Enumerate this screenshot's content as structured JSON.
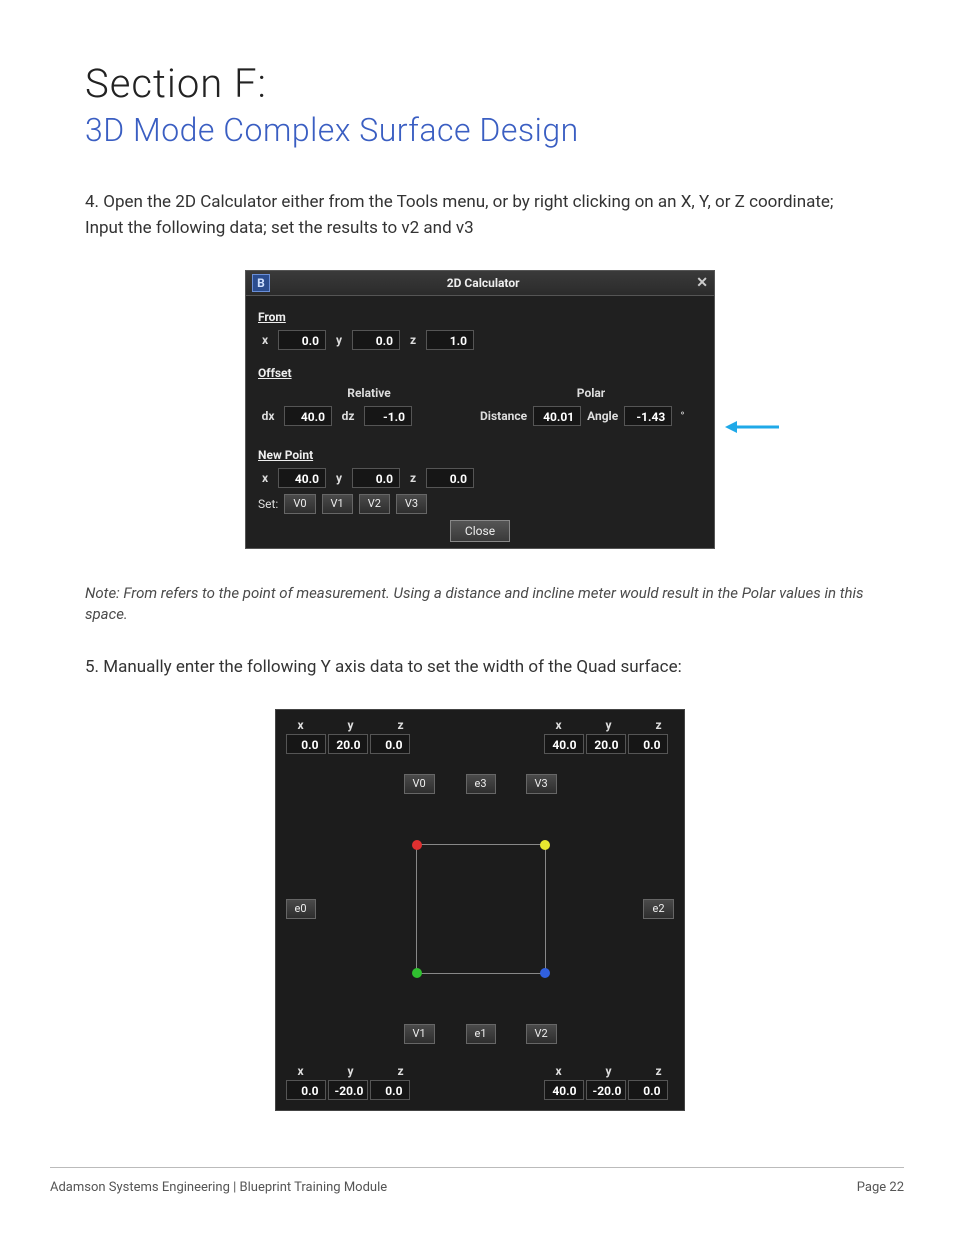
{
  "header": {
    "section": "Section F:",
    "title": "3D Mode Complex Surface Design"
  },
  "step4": {
    "num": "4.",
    "text": "Open the 2D Calculator either from the Tools menu, or by right clicking on an X, Y, or Z coordinate; Input the following data; set the results to v2 and v3"
  },
  "step5": {
    "num": "5.",
    "text": "Manually enter the following Y axis data to set the width of the Quad surface:"
  },
  "note": "Note: From refers to the point of measurement. Using a distance and incline meter would result in the Polar values in this space.",
  "calc": {
    "appIcon": "B",
    "title": "2D Calculator",
    "fromLabel": "From",
    "from": {
      "x": "0.0",
      "y": "0.0",
      "z": "1.0"
    },
    "offsetLabel": "Offset",
    "relativeLabel": "Relative",
    "polarLabel": "Polar",
    "relative": {
      "dx": "40.0",
      "dz": "-1.0"
    },
    "polar": {
      "distanceLabel": "Distance",
      "distance": "40.01",
      "angleLabel": "Angle",
      "angle": "-1.43",
      "unit": "°"
    },
    "newPointLabel": "New Point",
    "newPoint": {
      "x": "40.0",
      "y": "0.0",
      "z": "0.0"
    },
    "setLabel": "Set:",
    "setButtons": [
      "V0",
      "V1",
      "V2",
      "V3"
    ],
    "closeLabel": "Close",
    "labels": {
      "x": "x",
      "y": "y",
      "z": "z",
      "dx": "dx",
      "dz": "dz"
    }
  },
  "quad": {
    "hdr": {
      "x": "x",
      "y": "y",
      "z": "z"
    },
    "tl": {
      "x": "0.0",
      "y": "20.0",
      "z": "0.0"
    },
    "tr": {
      "x": "40.0",
      "y": "20.0",
      "z": "0.0"
    },
    "bl": {
      "x": "0.0",
      "y": "-20.0",
      "z": "0.0"
    },
    "br": {
      "x": "40.0",
      "y": "-20.0",
      "z": "0.0"
    },
    "buttons": {
      "v0": "V0",
      "e3": "e3",
      "v3": "V3",
      "e0": "e0",
      "e2": "e2",
      "v1": "V1",
      "e1": "e1",
      "v2": "V2"
    }
  },
  "footer": {
    "left": "Adamson Systems Engineering  |  Blueprint Training Module",
    "right": "Page 22"
  }
}
